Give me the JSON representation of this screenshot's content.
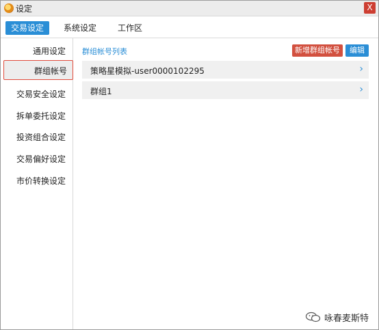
{
  "window": {
    "title": "设定",
    "close_label": "X"
  },
  "tabs": [
    {
      "label": "交易设定",
      "active": true
    },
    {
      "label": "系统设定",
      "active": false
    },
    {
      "label": "工作区",
      "active": false
    }
  ],
  "sidebar": {
    "items": [
      {
        "label": "通用设定"
      },
      {
        "label": "群组帐号",
        "selected": true
      },
      {
        "label": "交易安全设定"
      },
      {
        "label": "拆单委托设定"
      },
      {
        "label": "投资组合设定"
      },
      {
        "label": "交易偏好设定"
      },
      {
        "label": "市价转换设定"
      }
    ]
  },
  "main": {
    "list_title": "群组帐号列表",
    "add_button": "新增群组帐号",
    "edit_button": "编辑",
    "groups": [
      {
        "name": "策略星模拟-user0000102295"
      },
      {
        "name": "群组1"
      }
    ]
  },
  "watermark": {
    "text": "咏春麦斯特"
  },
  "colors": {
    "accent": "#2a8ed6",
    "danger": "#d2503f",
    "selection_border": "#e04b3b"
  }
}
